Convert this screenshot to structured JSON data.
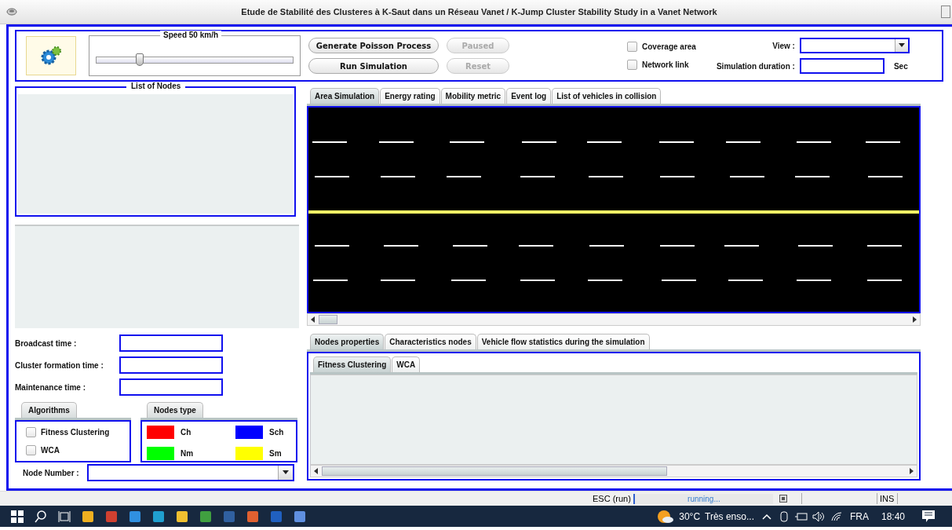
{
  "window": {
    "title": "Etude de Stabilité des Clusteres à K-Saut dans un Réseau Vanet / K-Jump Cluster Stability Study in a Vanet Network"
  },
  "top_panel": {
    "speed": {
      "label": "Speed 50 km/h",
      "level": 0.22
    },
    "buttons": [
      {
        "label": "Generate Poisson Process",
        "disabled": false
      },
      {
        "label": "Paused",
        "disabled": true
      },
      {
        "label": "Run Simulation",
        "disabled": false
      },
      {
        "label": "Reset",
        "disabled": true
      }
    ],
    "checkboxes": [
      {
        "label": "Coverage area",
        "checked": false
      },
      {
        "label": "Network link",
        "checked": false
      }
    ],
    "view_label": "View :",
    "duration_label": "Simulation duration :",
    "duration_unit": "Sec"
  },
  "list_of_nodes": {
    "title": "List of Nodes"
  },
  "time_fields": [
    {
      "label": "Broadcast time :"
    },
    {
      "label": "Cluster formation time :"
    },
    {
      "label": "Maintenance time :"
    }
  ],
  "algorithms": {
    "tab": "Algorithms",
    "options": [
      {
        "label": "Fitness Clustering",
        "checked": false
      },
      {
        "label": "WCA",
        "checked": false
      }
    ]
  },
  "nodes_type": {
    "tab": "Nodes type",
    "legend": [
      {
        "label": "Ch",
        "color": "#ff0000"
      },
      {
        "label": "Sch",
        "color": "#0000ff"
      },
      {
        "label": "Nm",
        "color": "#00ff00"
      },
      {
        "label": "Sm",
        "color": "#ffff00"
      }
    ]
  },
  "node_number_label": "Node Number :",
  "main_tabs": [
    {
      "label": "Area Simulation",
      "selected": true
    },
    {
      "label": "Energy rating",
      "selected": false
    },
    {
      "label": "Mobility metric",
      "selected": false
    },
    {
      "label": "Event log",
      "selected": false
    },
    {
      "label": "List of vehicles in collision",
      "selected": false
    }
  ],
  "bottom_tabs": [
    {
      "label": "Nodes properties",
      "selected": true
    },
    {
      "label": "Characteristics nodes",
      "selected": false
    },
    {
      "label": "Vehicle flow statistics during the simulation",
      "selected": false
    }
  ],
  "sub_tabs": [
    {
      "label": "Fitness Clustering",
      "selected": true
    },
    {
      "label": "WCA",
      "selected": false
    }
  ],
  "status_bar": {
    "key_hint": "ESC (run)",
    "progress_text": "running...",
    "mode": "INS"
  },
  "taskbar": {
    "temperature": "30°C",
    "weather": "Très enso...",
    "language": "FRA",
    "time": "18:40"
  }
}
